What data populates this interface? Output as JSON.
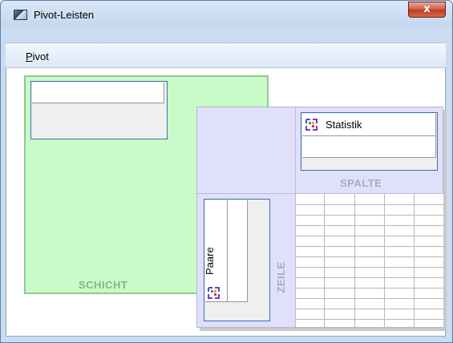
{
  "window": {
    "title": "Pivot-Leisten",
    "close_label": "x"
  },
  "menu": {
    "items": [
      {
        "label": "Pivot",
        "mnemonic": "P"
      }
    ]
  },
  "pivot": {
    "layer": {
      "caption": "SCHICHT"
    },
    "columns": {
      "caption": "SPALTE",
      "dimensions": [
        "Statistik"
      ]
    },
    "rows": {
      "caption": "ZEILE",
      "dimensions": [
        "Paare"
      ]
    }
  },
  "icons": {
    "app": "pivot-table-icon",
    "dimension": "dimension-icon"
  },
  "colors": {
    "layer_area": "#c9fbc9",
    "pivot_area": "#e0e0fa",
    "caption_text": "#a9a9c9",
    "layer_caption_text": "#8ab08a",
    "selection_border": "#3c6fb0"
  }
}
